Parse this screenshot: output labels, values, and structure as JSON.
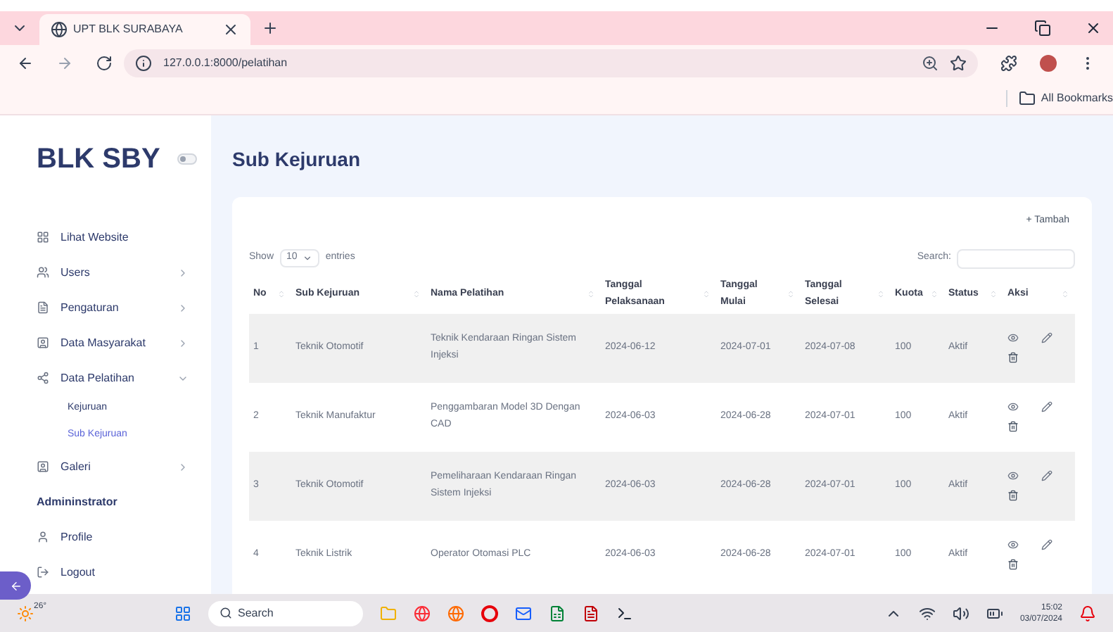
{
  "browser": {
    "tab_title": "UPT BLK SURABAYA",
    "url": "127.0.0.1:8000/pelatihan",
    "bookmarks": "All Bookmarks"
  },
  "sidebar": {
    "brand": "BLK SBY",
    "dark_mode": false,
    "items": [
      {
        "kind": "link",
        "label": "Lihat Website"
      },
      {
        "kind": "group",
        "label": "Users",
        "expanded": false
      },
      {
        "kind": "group",
        "label": "Pengaturan",
        "expanded": false
      },
      {
        "kind": "group",
        "label": "Data Masyarakat",
        "expanded": false
      },
      {
        "kind": "group",
        "label": "Data Pelatihan",
        "expanded": true,
        "children": [
          {
            "label": "Kejuruan",
            "selected": false
          },
          {
            "label": "Sub Kejuruan",
            "selected": true
          }
        ]
      },
      {
        "kind": "group",
        "label": "Galeri",
        "expanded": false
      },
      {
        "kind": "heading",
        "label": "Admininstrator"
      },
      {
        "kind": "link",
        "label": "Profile"
      },
      {
        "kind": "link",
        "label": "Logout"
      }
    ]
  },
  "page_title": "Sub Kejuruan",
  "add_button": "+ Tambah",
  "show_entries": {
    "before": "Show",
    "value": "10",
    "after": "entries"
  },
  "search": {
    "label": "Search:"
  },
  "table": {
    "columns": [
      "No",
      "Sub Kejuruan",
      "Nama Pelatihan",
      "Tanggal Pelaksanaan",
      "Tanggal Mulai",
      "Tanggal Selesai",
      "Kuota",
      "Status",
      "Aksi"
    ],
    "rows": [
      {
        "cells": [
          "1",
          "Teknik Otomotif",
          "Teknik Kendaraan Ringan Sistem Injeksi",
          "2024-06-12",
          "2024-07-01",
          "2024-07-08",
          "100",
          "Aktif"
        ]
      },
      {
        "cells": [
          "2",
          "Teknik Manufaktur",
          "Penggambaran Model 3D Dengan CAD",
          "2024-06-03",
          "2024-06-28",
          "2024-07-01",
          "100",
          "Aktif"
        ]
      },
      {
        "cells": [
          "3",
          "Teknik Otomotif",
          "Pemeliharaan Kendaraan Ringan Sistem Injeksi",
          "2024-06-03",
          "2024-06-28",
          "2024-07-01",
          "100",
          "Aktif"
        ]
      },
      {
        "cells": [
          "4",
          "Teknik Listrik",
          "Operator Otomasi PLC",
          "2024-06-03",
          "2024-06-28",
          "2024-07-01",
          "100",
          "Aktif"
        ]
      }
    ]
  },
  "taskbar": {
    "weather": "26°",
    "search": "Search",
    "time": "15:02",
    "date": "03/07/2024"
  }
}
